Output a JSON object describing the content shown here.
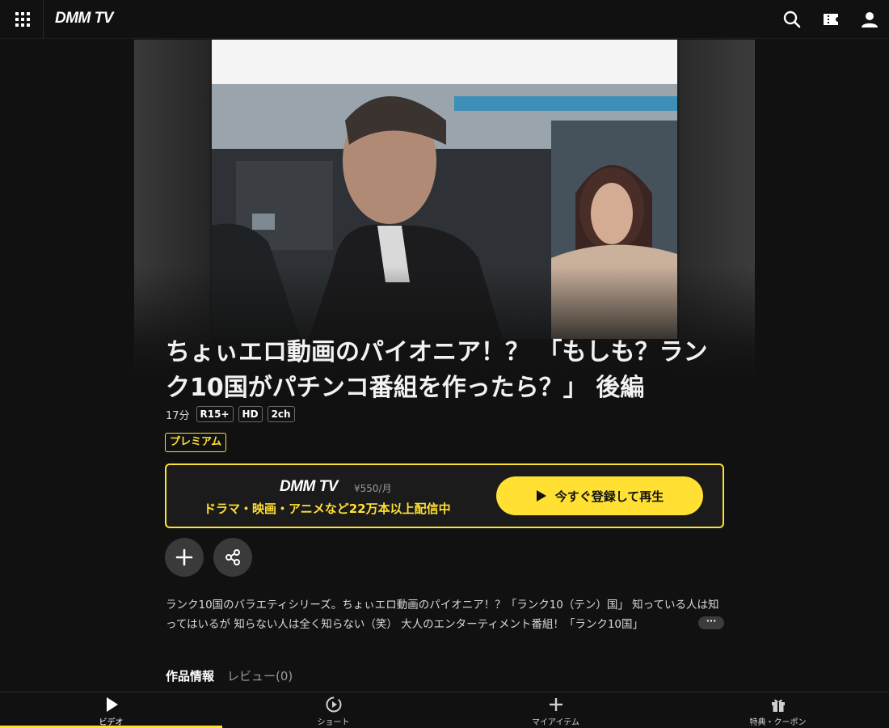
{
  "header": {
    "logo": "DMM TV",
    "icons": [
      "apps-grid-icon",
      "search-icon",
      "ticket-icon",
      "user-icon"
    ]
  },
  "title": "ちょぃエロ動画のパイオニア！？ 「もしも？ランク10国がパチンコ番組を作ったら？」 後編",
  "meta": {
    "duration": "17分",
    "badges": [
      "R15+",
      "HD",
      "2ch"
    ]
  },
  "premium_label": "プレミアム",
  "promo": {
    "logo": "DMM TV",
    "price": "¥550/月",
    "text": "ドラマ・映画・アニメなど22万本以上配信中",
    "cta_label": "今すぐ登録して再生"
  },
  "actions": [
    "add-icon",
    "share-icon"
  ],
  "description": "ランク10国のバラエティシリーズ。ちょぃエロ動画のパイオニア！？「ランク10（テン）国」 知っている人は知ってはいるが 知らない人は全く知らない（笑） 大人のエンターティメント番組！「ランク10国」 ",
  "more_label": "···",
  "tabs": [
    "作品情報",
    "レビュー(0)"
  ],
  "bottom_nav": [
    {
      "label": "ビデオ",
      "icon": "play-icon",
      "active": true
    },
    {
      "label": "ショート",
      "icon": "short-video-icon",
      "active": false
    },
    {
      "label": "マイアイテム",
      "icon": "plus-icon",
      "active": false
    },
    {
      "label": "特典・クーポン",
      "icon": "gift-icon",
      "active": false
    }
  ],
  "colors": {
    "accent": "#ffe033",
    "background": "#111111"
  }
}
